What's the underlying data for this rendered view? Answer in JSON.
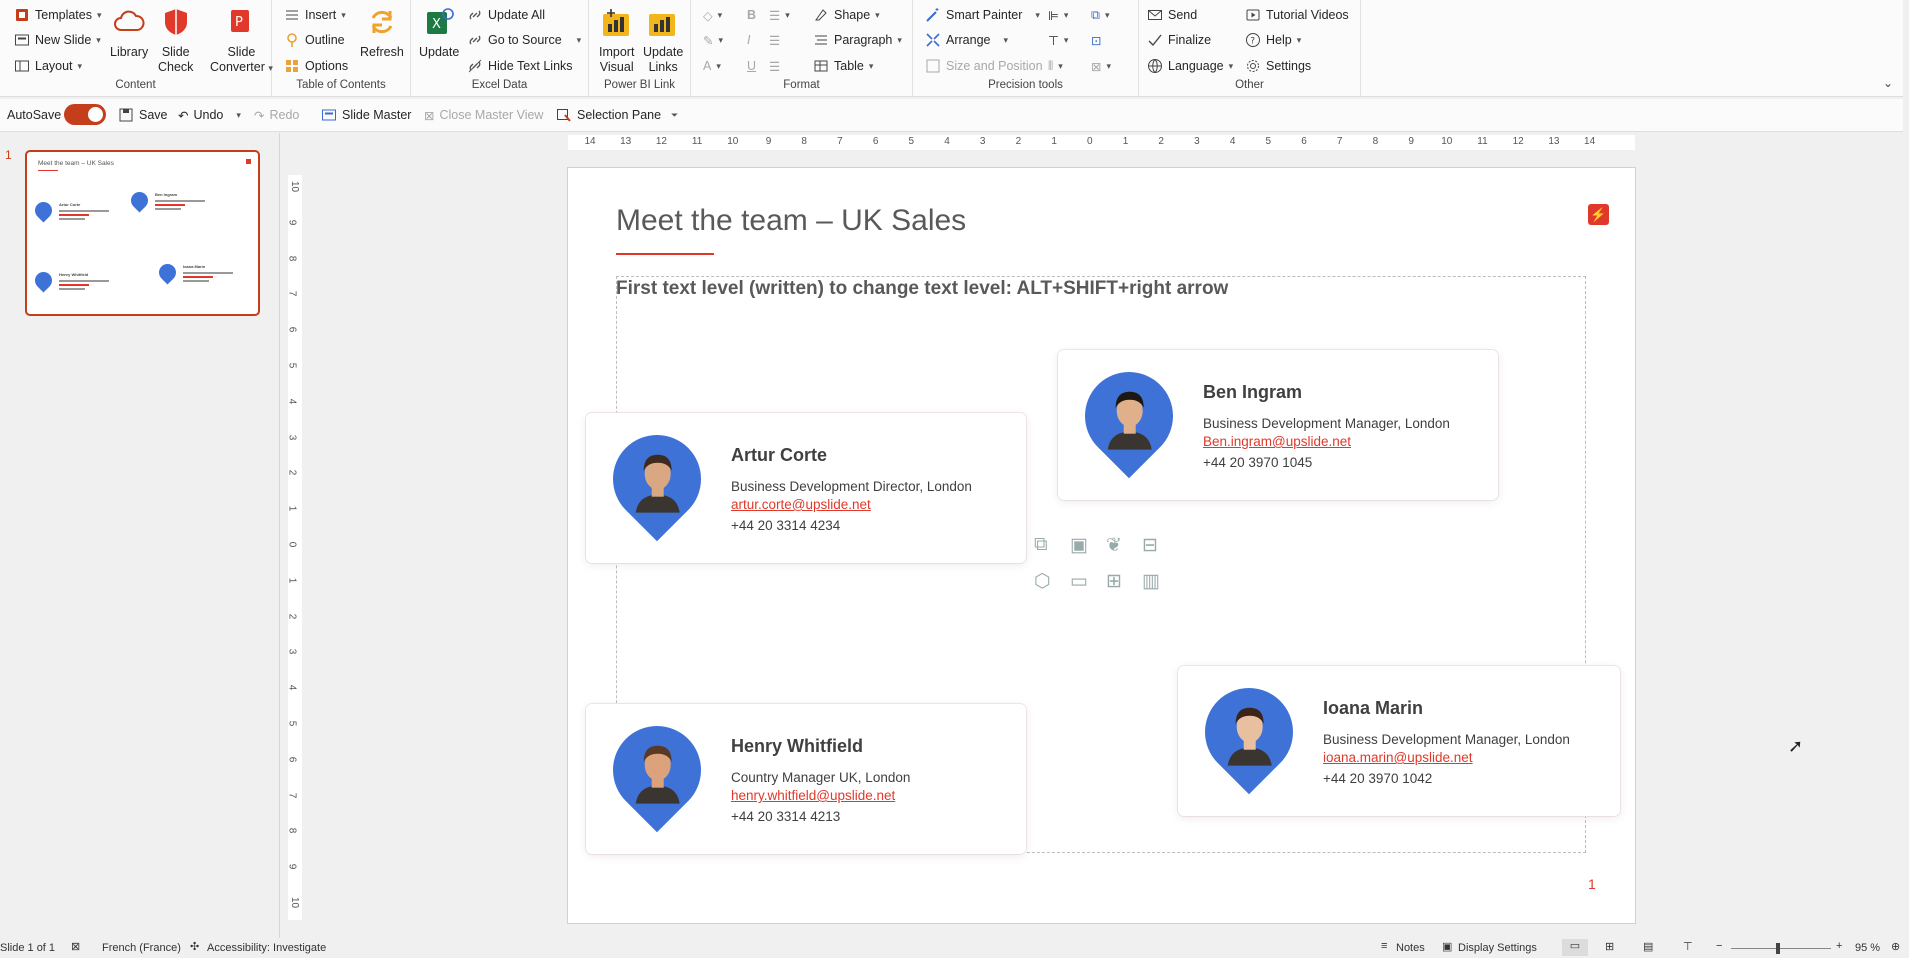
{
  "ribbon": {
    "content": {
      "label": "Content",
      "templates": "Templates",
      "new_slide": "New Slide",
      "layout": "Layout",
      "library": "Library",
      "slide_check": [
        "Slide",
        "Check"
      ],
      "slide_converter": [
        "Slide",
        "Converter"
      ]
    },
    "toc": {
      "label": "Table of Contents",
      "insert": "Insert",
      "outline": "Outline",
      "options": "Options",
      "refresh": "Refresh"
    },
    "excel": {
      "label": "Excel Data",
      "update": "Update",
      "update_all": "Update All",
      "go_to_source": "Go to Source",
      "hide_text_links": "Hide Text Links"
    },
    "powerbi": {
      "label": "Power BI Link",
      "import_visual": [
        "Import",
        "Visual"
      ],
      "update_links": [
        "Update",
        "Links"
      ]
    },
    "format": {
      "label": "Format",
      "shape": "Shape",
      "paragraph": "Paragraph",
      "table": "Table",
      "bold": "B",
      "italic": "I",
      "underline": "U"
    },
    "precision": {
      "label": "Precision tools",
      "smart_painter": "Smart Painter",
      "arrange": "Arrange",
      "size_position": "Size and Position"
    },
    "other": {
      "label": "Other",
      "send": "Send",
      "finalize": "Finalize",
      "language": "Language",
      "tutorial_videos": "Tutorial Videos",
      "help": "Help",
      "settings": "Settings"
    }
  },
  "qat": {
    "autosave": "AutoSave",
    "save": "Save",
    "undo": "Undo",
    "redo": "Redo",
    "slide_master": "Slide Master",
    "close_master": "Close Master View",
    "selection_pane": "Selection Pane"
  },
  "thumbnail": {
    "number": "1"
  },
  "ruler_h": [
    "14",
    "13",
    "12",
    "11",
    "10",
    "9",
    "8",
    "7",
    "6",
    "5",
    "4",
    "3",
    "2",
    "1",
    "0",
    "1",
    "2",
    "3",
    "4",
    "5",
    "6",
    "7",
    "8",
    "9",
    "10",
    "11",
    "12",
    "13",
    "14"
  ],
  "ruler_v": [
    "10",
    "9",
    "8",
    "7",
    "6",
    "5",
    "4",
    "3",
    "2",
    "1",
    "0",
    "1",
    "2",
    "3",
    "4",
    "5",
    "6",
    "7",
    "8",
    "9",
    "10"
  ],
  "slide": {
    "title": "Meet the team – UK Sales",
    "placeholder": "First text level (written) to change text level: ALT+SHIFT+right arrow",
    "page_number": "1",
    "people": [
      {
        "name": "Artur Corte",
        "role": "Business Development Director, London",
        "email": "artur.corte@upslide.net",
        "phone": "+44 20 3314 4234"
      },
      {
        "name": "Ben Ingram",
        "role": "Business Development Manager, London",
        "email": "Ben.ingram@upslide.net",
        "phone": "+44 20 3970 1045"
      },
      {
        "name": "Henry Whitfield",
        "role": "Country Manager UK, London",
        "email": "henry.whitfield@upslide.net",
        "phone": "+44 20 3314 4213"
      },
      {
        "name": "Ioana Marin",
        "role": "Business Development Manager, London",
        "email": "ioana.marin@upslide.net",
        "phone": "+44 20 3970 1042"
      }
    ]
  },
  "status": {
    "slide": "Slide 1 of 1",
    "language": "French (France)",
    "accessibility": "Accessibility: Investigate",
    "notes": "Notes",
    "display_settings": "Display Settings",
    "zoom": "95 %"
  },
  "colors": {
    "accent": "#c43e1c",
    "pin": "#3f72d6",
    "link": "#e0392b"
  }
}
